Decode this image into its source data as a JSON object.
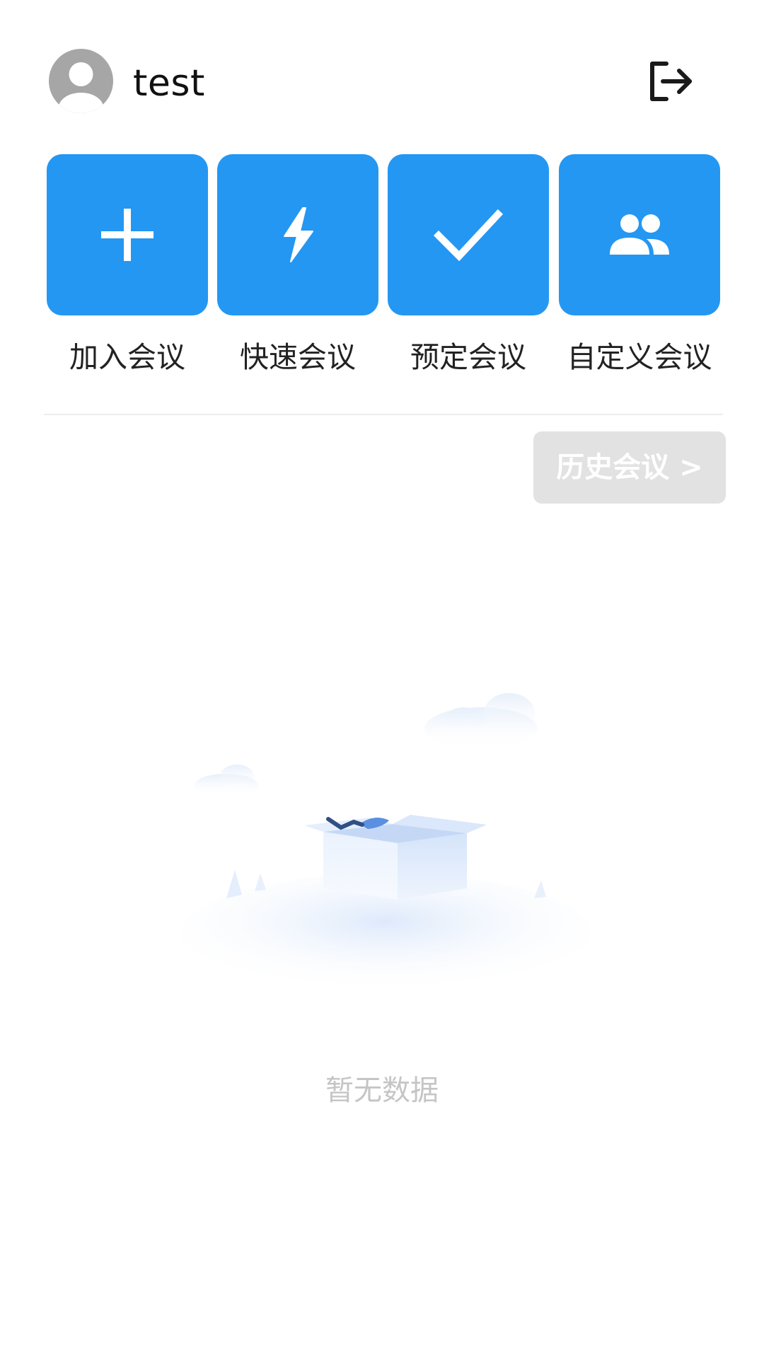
{
  "header": {
    "username": "test",
    "avatar_icon": "user-avatar-icon",
    "logout_icon": "logout-icon"
  },
  "actions": [
    {
      "label": "加入会议",
      "icon": "plus-icon"
    },
    {
      "label": "快速会议",
      "icon": "lightning-icon"
    },
    {
      "label": "预定会议",
      "icon": "check-icon"
    },
    {
      "label": "自定义会议",
      "icon": "people-icon"
    }
  ],
  "history_button": {
    "label": "历史会议 >"
  },
  "empty_state": {
    "text": "暂无数据",
    "illustration": "empty-box-illustration"
  },
  "colors": {
    "accent": "#2497f2",
    "avatar": "#a6a6a6",
    "history_button_bg": "#e2e2e2",
    "empty_text": "#c5c5c5"
  }
}
